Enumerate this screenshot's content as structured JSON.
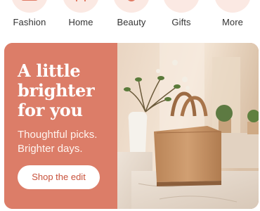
{
  "categories": [
    {
      "label": "Fashion",
      "icon": "shirt-icon"
    },
    {
      "label": "Home",
      "icon": "chair-icon"
    },
    {
      "label": "Beauty",
      "icon": "perfume-icon"
    },
    {
      "label": "Gifts",
      "icon": "gift-icon"
    },
    {
      "label": "More",
      "icon": "more-icon"
    }
  ],
  "hero": {
    "headline": "A little\nbrighter\nfor you",
    "subtext": "Thoughtful picks.\nBrighter days.",
    "cta_label": "Shop the edit",
    "image": "tan-handbag-on-marble-pedestal",
    "colors": {
      "panel": "#dc7d68",
      "cta_text": "#c8523c",
      "icon_tint": "#e07a64"
    }
  }
}
